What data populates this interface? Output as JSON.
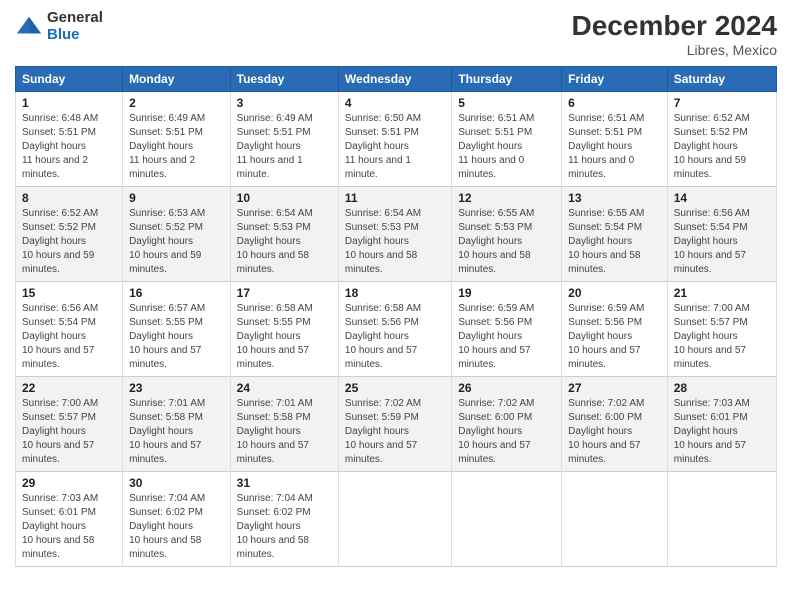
{
  "logo": {
    "general": "General",
    "blue": "Blue"
  },
  "title": {
    "month": "December 2024",
    "location": "Libres, Mexico"
  },
  "days_of_week": [
    "Sunday",
    "Monday",
    "Tuesday",
    "Wednesday",
    "Thursday",
    "Friday",
    "Saturday"
  ],
  "weeks": [
    [
      {
        "day": "1",
        "sunrise": "6:48 AM",
        "sunset": "5:51 PM",
        "daylight": "11 hours and 2 minutes."
      },
      {
        "day": "2",
        "sunrise": "6:49 AM",
        "sunset": "5:51 PM",
        "daylight": "11 hours and 2 minutes."
      },
      {
        "day": "3",
        "sunrise": "6:49 AM",
        "sunset": "5:51 PM",
        "daylight": "11 hours and 1 minute."
      },
      {
        "day": "4",
        "sunrise": "6:50 AM",
        "sunset": "5:51 PM",
        "daylight": "11 hours and 1 minute."
      },
      {
        "day": "5",
        "sunrise": "6:51 AM",
        "sunset": "5:51 PM",
        "daylight": "11 hours and 0 minutes."
      },
      {
        "day": "6",
        "sunrise": "6:51 AM",
        "sunset": "5:51 PM",
        "daylight": "11 hours and 0 minutes."
      },
      {
        "day": "7",
        "sunrise": "6:52 AM",
        "sunset": "5:52 PM",
        "daylight": "10 hours and 59 minutes."
      }
    ],
    [
      {
        "day": "8",
        "sunrise": "6:52 AM",
        "sunset": "5:52 PM",
        "daylight": "10 hours and 59 minutes."
      },
      {
        "day": "9",
        "sunrise": "6:53 AM",
        "sunset": "5:52 PM",
        "daylight": "10 hours and 59 minutes."
      },
      {
        "day": "10",
        "sunrise": "6:54 AM",
        "sunset": "5:53 PM",
        "daylight": "10 hours and 58 minutes."
      },
      {
        "day": "11",
        "sunrise": "6:54 AM",
        "sunset": "5:53 PM",
        "daylight": "10 hours and 58 minutes."
      },
      {
        "day": "12",
        "sunrise": "6:55 AM",
        "sunset": "5:53 PM",
        "daylight": "10 hours and 58 minutes."
      },
      {
        "day": "13",
        "sunrise": "6:55 AM",
        "sunset": "5:54 PM",
        "daylight": "10 hours and 58 minutes."
      },
      {
        "day": "14",
        "sunrise": "6:56 AM",
        "sunset": "5:54 PM",
        "daylight": "10 hours and 57 minutes."
      }
    ],
    [
      {
        "day": "15",
        "sunrise": "6:56 AM",
        "sunset": "5:54 PM",
        "daylight": "10 hours and 57 minutes."
      },
      {
        "day": "16",
        "sunrise": "6:57 AM",
        "sunset": "5:55 PM",
        "daylight": "10 hours and 57 minutes."
      },
      {
        "day": "17",
        "sunrise": "6:58 AM",
        "sunset": "5:55 PM",
        "daylight": "10 hours and 57 minutes."
      },
      {
        "day": "18",
        "sunrise": "6:58 AM",
        "sunset": "5:56 PM",
        "daylight": "10 hours and 57 minutes."
      },
      {
        "day": "19",
        "sunrise": "6:59 AM",
        "sunset": "5:56 PM",
        "daylight": "10 hours and 57 minutes."
      },
      {
        "day": "20",
        "sunrise": "6:59 AM",
        "sunset": "5:56 PM",
        "daylight": "10 hours and 57 minutes."
      },
      {
        "day": "21",
        "sunrise": "7:00 AM",
        "sunset": "5:57 PM",
        "daylight": "10 hours and 57 minutes."
      }
    ],
    [
      {
        "day": "22",
        "sunrise": "7:00 AM",
        "sunset": "5:57 PM",
        "daylight": "10 hours and 57 minutes."
      },
      {
        "day": "23",
        "sunrise": "7:01 AM",
        "sunset": "5:58 PM",
        "daylight": "10 hours and 57 minutes."
      },
      {
        "day": "24",
        "sunrise": "7:01 AM",
        "sunset": "5:58 PM",
        "daylight": "10 hours and 57 minutes."
      },
      {
        "day": "25",
        "sunrise": "7:02 AM",
        "sunset": "5:59 PM",
        "daylight": "10 hours and 57 minutes."
      },
      {
        "day": "26",
        "sunrise": "7:02 AM",
        "sunset": "6:00 PM",
        "daylight": "10 hours and 57 minutes."
      },
      {
        "day": "27",
        "sunrise": "7:02 AM",
        "sunset": "6:00 PM",
        "daylight": "10 hours and 57 minutes."
      },
      {
        "day": "28",
        "sunrise": "7:03 AM",
        "sunset": "6:01 PM",
        "daylight": "10 hours and 57 minutes."
      }
    ],
    [
      {
        "day": "29",
        "sunrise": "7:03 AM",
        "sunset": "6:01 PM",
        "daylight": "10 hours and 58 minutes."
      },
      {
        "day": "30",
        "sunrise": "7:04 AM",
        "sunset": "6:02 PM",
        "daylight": "10 hours and 58 minutes."
      },
      {
        "day": "31",
        "sunrise": "7:04 AM",
        "sunset": "6:02 PM",
        "daylight": "10 hours and 58 minutes."
      },
      null,
      null,
      null,
      null
    ]
  ],
  "labels": {
    "sunrise": "Sunrise:",
    "sunset": "Sunset:",
    "daylight": "Daylight hours"
  }
}
